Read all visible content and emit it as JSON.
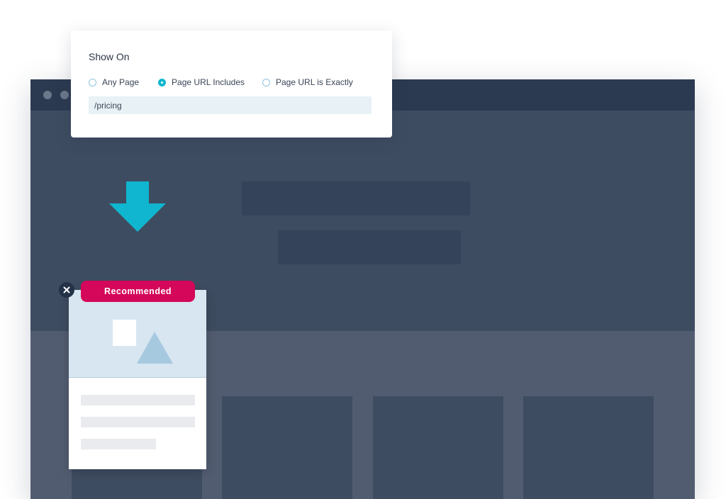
{
  "settings": {
    "title": "Show On",
    "options": [
      {
        "label": "Any Page",
        "selected": false
      },
      {
        "label": "Page URL Includes",
        "selected": true
      },
      {
        "label": "Page URL is Exactly",
        "selected": false
      }
    ],
    "url_value": "/pricing"
  },
  "popup": {
    "badge": "Recommended",
    "close_icon": "close-icon",
    "image_icon": "image-placeholder-icon"
  },
  "arrow_icon": "arrow-down-icon",
  "colors": {
    "accent": "#10b6cf",
    "badge": "#d4075a",
    "browser_bg": "#3e4c61",
    "browser_bar": "#2c3a51"
  }
}
